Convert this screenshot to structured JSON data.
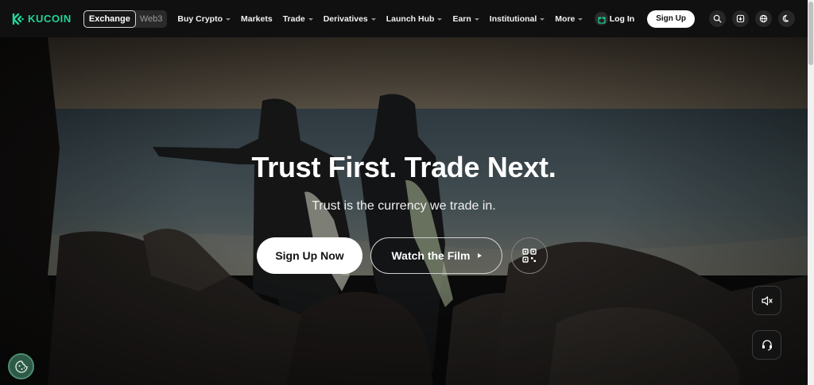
{
  "brand": {
    "name": "KUCOIN",
    "accent": "#23d39a"
  },
  "nav": {
    "switch": [
      "Exchange",
      "Web3"
    ],
    "menu": [
      {
        "label": "Buy Crypto",
        "dropdown": true
      },
      {
        "label": "Markets",
        "dropdown": false
      },
      {
        "label": "Trade",
        "dropdown": true
      },
      {
        "label": "Derivatives",
        "dropdown": true
      },
      {
        "label": "Launch Hub",
        "dropdown": true
      },
      {
        "label": "Earn",
        "dropdown": true
      },
      {
        "label": "Institutional",
        "dropdown": true
      },
      {
        "label": "More",
        "dropdown": true
      }
    ],
    "login_label": "Log In",
    "signup_label": "Sign Up",
    "icons": [
      "search-icon",
      "download-icon",
      "globe-icon",
      "theme-moon-icon"
    ]
  },
  "hero": {
    "headline": "Trust First. Trade Next.",
    "subline": "Trust is the currency we trade in.",
    "primary_cta": "Sign Up Now",
    "secondary_cta": "Watch the Film",
    "qr_icon": "qr-code-icon",
    "mute_icon": "speaker-muted-icon",
    "support_icon": "headset-icon"
  },
  "cookie_icon": "cookie-icon"
}
